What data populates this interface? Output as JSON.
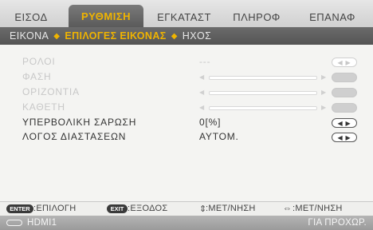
{
  "tabs": [
    {
      "label": "ΕΙΣΟΔ",
      "active": false
    },
    {
      "label": "ΡΥΘΜΙΣΗ",
      "active": true
    },
    {
      "label": "ΕΓΚΑΤΑΣΤ",
      "active": false
    },
    {
      "label": "ΠΛΗΡΟΦ",
      "active": false
    },
    {
      "label": "ΕΠΑΝΑΦ",
      "active": false
    }
  ],
  "subtabs": {
    "left": "ΕΙΚΟΝΑ",
    "current": "ΕΠΙΛΟΓΕΣ ΕΙΚΟΝΑΣ",
    "right": "ΗΧΟΣ",
    "separator": "◆"
  },
  "rows": [
    {
      "label": "ΡΟΛΟΙ",
      "value": "---",
      "enabled": false,
      "control": "lr-pill"
    },
    {
      "label": "ΦΑΣΗ",
      "value": "",
      "enabled": false,
      "control": "slider"
    },
    {
      "label": "ΟΡΙΖΟΝΤΙΑ",
      "value": "",
      "enabled": false,
      "control": "slider"
    },
    {
      "label": "ΚΑΘΕΤΗ",
      "value": "",
      "enabled": false,
      "control": "slider"
    },
    {
      "label": "ΥΠΕΡΒΟΛΙΚΗ ΣΑΡΩΣΗ",
      "value": "0[%]",
      "enabled": true,
      "control": "lr-pill"
    },
    {
      "label": "ΛΟΓΟΣ ΔΙΑΣΤΑΣΕΩΝ",
      "value": "ΑΥΤΟΜ.",
      "enabled": true,
      "control": "lr-pill"
    }
  ],
  "glyphs": {
    "left": "◀",
    "right": "▶",
    "lr": "◀ ▶",
    "updown": "⇕",
    "leftright": "⇔"
  },
  "help": {
    "enter_key": "ENTER",
    "enter_text": ":ΕΠΙΛΟΓΗ",
    "exit_key": "EXIT",
    "exit_text": ":ΕΞΟΔΟΣ",
    "move1_text": ":ΜΕΤ/ΝΗΣΗ",
    "move2_text": ":ΜΕΤ/ΝΗΣΗ"
  },
  "status": {
    "source": "HDMI1",
    "right": "ΓΙΑ ΠΡΟΧΩΡ."
  },
  "colors": {
    "accent": "#f0b400",
    "tab_active_bg": "#5f5f5f",
    "disabled_text": "#c8c8c8"
  }
}
